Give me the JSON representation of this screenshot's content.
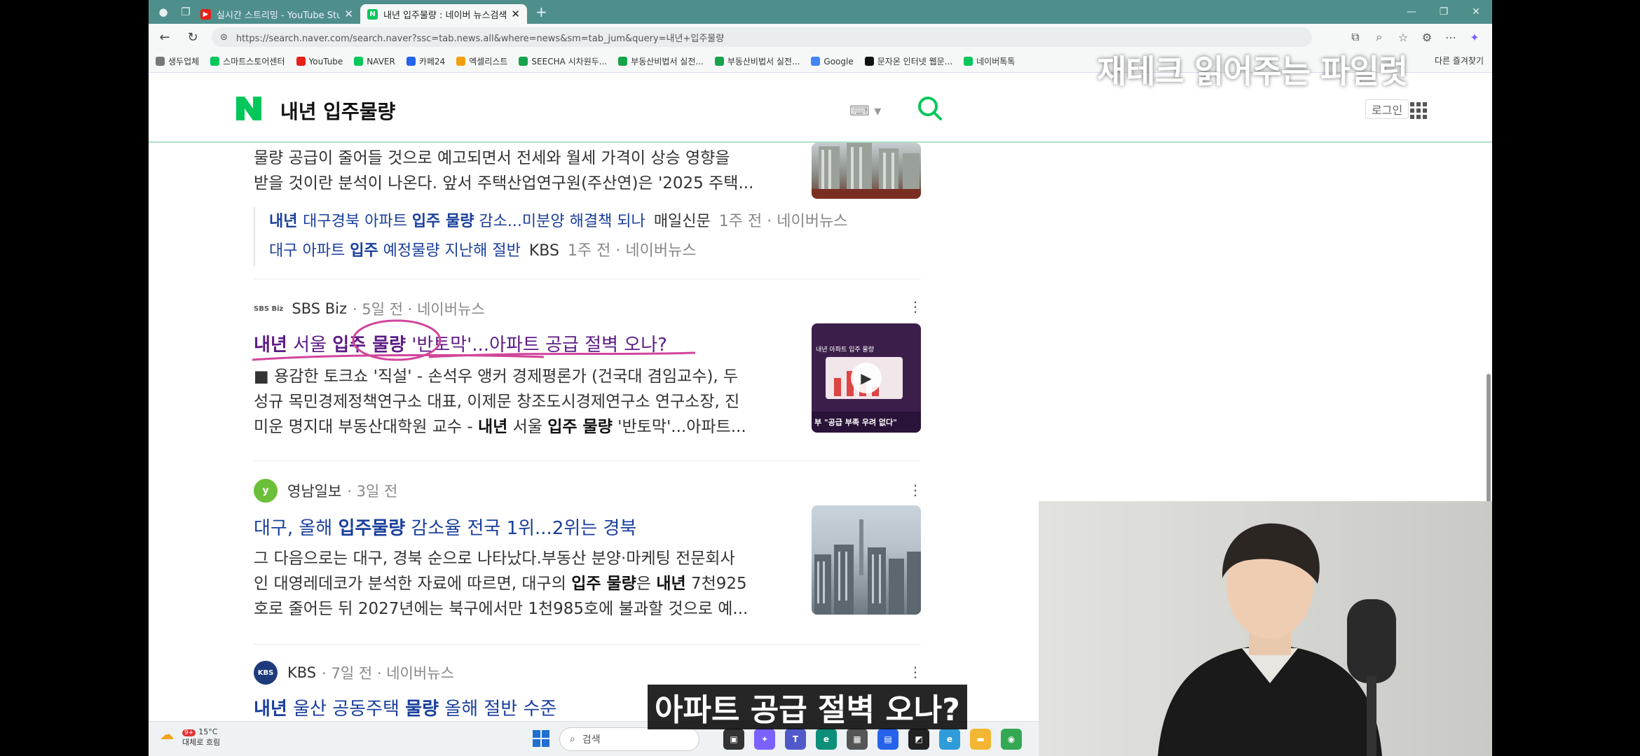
{
  "browser": {
    "tabs": [
      {
        "label": "실시간 스트리밍 - YouTube Studio",
        "favicon_color": "#e62117",
        "active": false
      },
      {
        "label": "내년 입주물량 : 네이버 뉴스검색",
        "favicon_color": "#03c75a",
        "active": true
      }
    ],
    "url": "https://search.naver.com/search.naver?ssc=tab.news.all&where=news&sm=tab_jum&query=내년+입주물량",
    "bookmarks": [
      {
        "label": "생두업체",
        "icon": "folder-icon",
        "color": "#777"
      },
      {
        "label": "스마트스토어센터",
        "icon": "smartstore-icon",
        "color": "#03c75a"
      },
      {
        "label": "YouTube",
        "icon": "youtube-icon",
        "color": "#e62117"
      },
      {
        "label": "NAVER",
        "icon": "naver-icon",
        "color": "#03c75a"
      },
      {
        "label": "카페24",
        "icon": "cafe24-icon",
        "color": "#2563eb"
      },
      {
        "label": "엑셀리스트",
        "icon": "excel-icon",
        "color": "#f59e0b"
      },
      {
        "label": "SEECHA 시차원두...",
        "icon": "seecha-icon",
        "color": "#16a34a"
      },
      {
        "label": "부동산비법서 실전...",
        "icon": "realestate-icon",
        "color": "#16a34a"
      },
      {
        "label": "부동산비법서 실전...",
        "icon": "realestate-icon",
        "color": "#16a34a"
      },
      {
        "label": "Google",
        "icon": "google-icon",
        "color": "#4285f4"
      },
      {
        "label": "문자온 인터넷 웹문...",
        "icon": "munja-icon",
        "color": "#111"
      },
      {
        "label": "네이버톡톡",
        "icon": "talktalk-icon",
        "color": "#03c75a"
      }
    ],
    "bookmarks_right": "다른 즐겨찾기"
  },
  "naver": {
    "query": "내년 입주물량",
    "login_label": "로그인",
    "accent": "#03c75a"
  },
  "results": {
    "first": {
      "snippet_line1": "물량 공급이 줄어들 것으로 예고되면서 전세와 월세 가격이 상승 영향을",
      "snippet_line2": "받을 것이란 분석이 나온다. 앞서 주택산업연구원(주산연)은 '2025 주택...",
      "related": [
        {
          "pre": "내년 ",
          "pre_bold": true,
          "t1": "대구경북 아파트 ",
          "b1": "입주 물량",
          "t2": " 감소...미분양 해결책 되나",
          "press": "매일신문",
          "meta": "1주 전 · 네이버뉴스"
        },
        {
          "pre": "",
          "pre_bold": false,
          "t1": "대구 아파트 ",
          "b1": "입주",
          "t2": " 예정물량 지난해 절반",
          "press": "KBS",
          "meta": "1주 전 · 네이버뉴스"
        }
      ]
    },
    "second": {
      "press": "SBS Biz",
      "meta": "· 5일 전 · 네이버뉴스",
      "title_parts": [
        "내년",
        " 서울 ",
        "입주 물량",
        " '반토막'...아파트 공급 절벽 오나?"
      ],
      "snippet_line1": "■ 용감한 토크쇼 '직설' - 손석우 앵커 경제평론가 (건국대 겸임교수), 두",
      "snippet_line2": "성규 목민경제정책연구소 대표, 이제문 창조도시경제연구소 연구소장, 진",
      "snippet_line3_pre": "미운 명지대 부동산대학원 교수 - ",
      "snippet_line3_b1": "내년",
      "snippet_line3_mid": " 서울 ",
      "snippet_line3_b2": "입주 물량",
      "snippet_line3_post": " '반토막'...아파트...",
      "thumb_caption": "부 \"공급 부족 우려 없다\"",
      "thumb_title": "내년 아파트 입주 물량"
    },
    "third": {
      "press": "영남일보",
      "meta": "· 3일 전",
      "title_pre": "대구, 올해 ",
      "title_b": "입주물량",
      "title_post": " 감소율 전국 1위...2위는 경북",
      "snippet_line1": "그 다음으로는 대구, 경북 순으로 나타났다.부동산 분양·마케팅 전문회사",
      "snippet_line2_pre": "인 대영레데코가 분석한 자료에 따르면, 대구의 ",
      "snippet_line2_b1": "입주 물량",
      "snippet_line2_mid": "은 ",
      "snippet_line2_b2": "내년",
      "snippet_line2_post": " 7천925",
      "snippet_line3": "호로 줄어든 뒤 2027년에는 북구에서만 1천985호에 불과할 것으로 예..."
    },
    "fourth": {
      "press": "KBS",
      "meta": "· 7일 전 · 네이버뉴스",
      "title_b1": "내년",
      "title_mid": " 울산 공동주택 ",
      "title_b2": "물량",
      "title_post": " 올해 절반 수준"
    }
  },
  "taskbar": {
    "temp": "15°C",
    "weather": "대체로 흐림",
    "badge": "9+",
    "search_placeholder": "검색"
  },
  "overlay": {
    "channel_name": "재테크 읽어주는 파일럿",
    "subtitle": "아파트 공급 절벽 오나?"
  }
}
